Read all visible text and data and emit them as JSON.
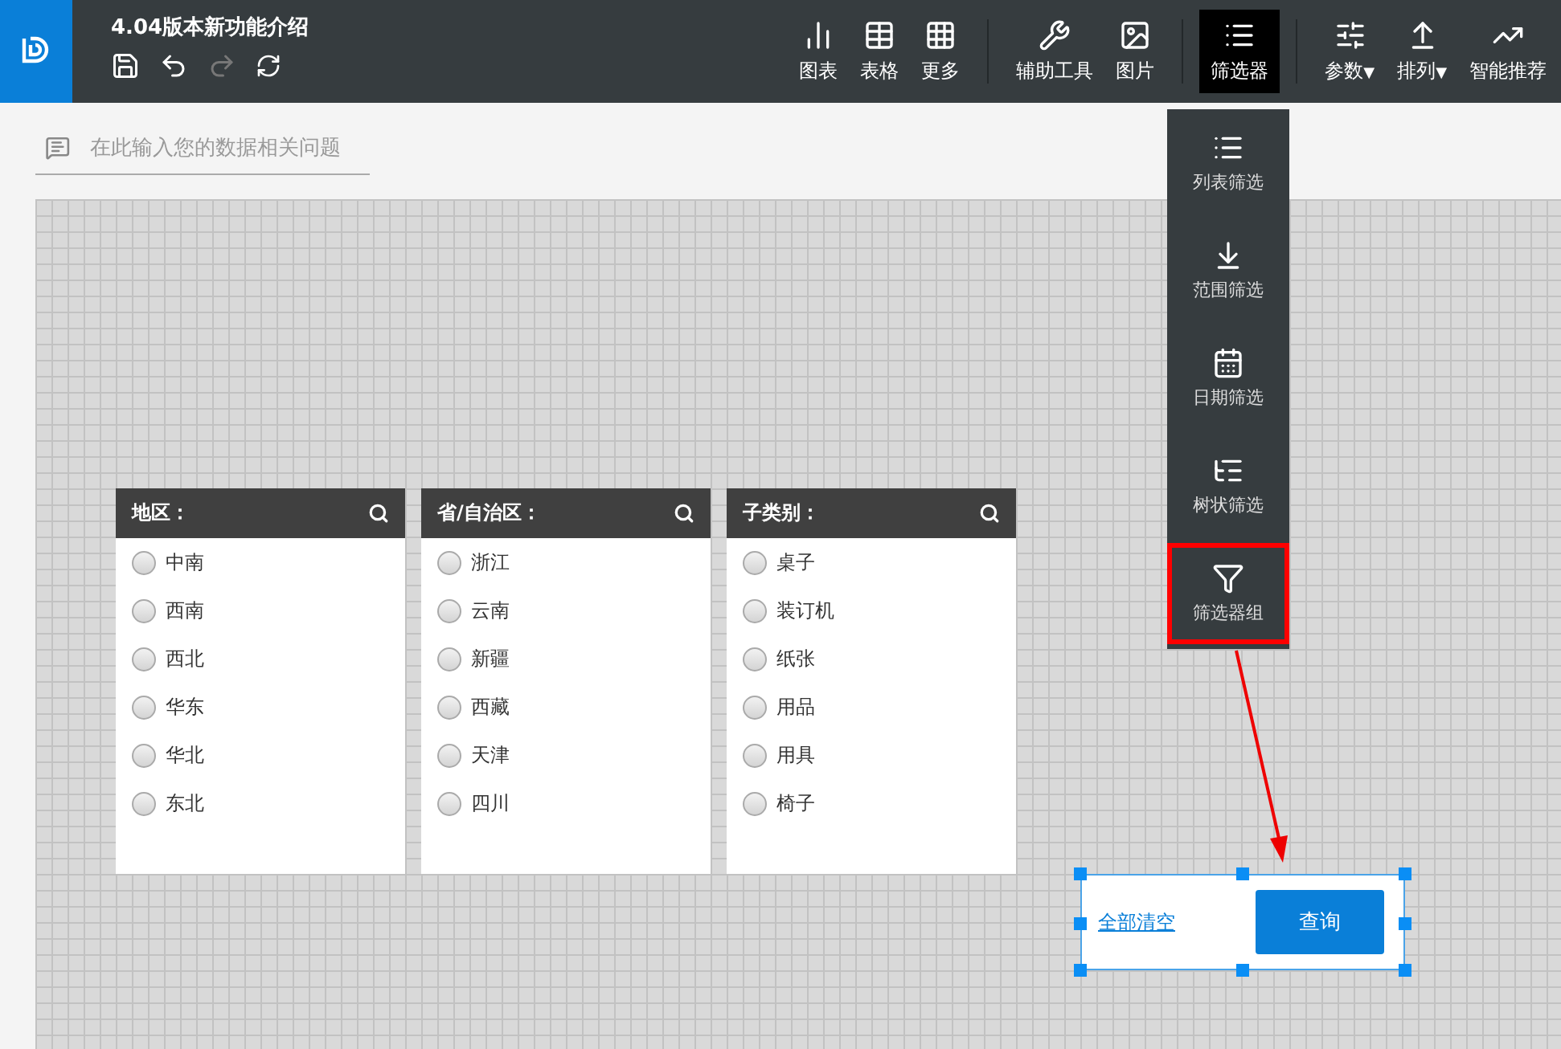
{
  "app": {
    "title": "4.04版本新功能介绍"
  },
  "toolbar": [
    {
      "label": "图表",
      "selected": false
    },
    {
      "label": "表格",
      "selected": false
    },
    {
      "label": "更多",
      "selected": false
    },
    {
      "label": "辅助工具",
      "selected": false
    },
    {
      "label": "图片",
      "selected": false
    },
    {
      "label": "筛选器",
      "selected": true
    },
    {
      "label": "参数",
      "caret": "▼",
      "selected": false
    },
    {
      "label": "排列",
      "caret": "▼",
      "selected": false
    },
    {
      "label": "智能推荐",
      "selected": false
    }
  ],
  "question": {
    "placeholder": "在此输入您的数据相关问题"
  },
  "filter_menu": [
    {
      "label": "列表筛选",
      "highlighted": false
    },
    {
      "label": "范围筛选",
      "highlighted": false
    },
    {
      "label": "日期筛选",
      "highlighted": false
    },
    {
      "label": "树状筛选",
      "highlighted": false
    },
    {
      "label": "筛选器组",
      "highlighted": true
    }
  ],
  "panels": [
    {
      "title": "地区：",
      "options": [
        {
          "label": "中南",
          "checked": false
        },
        {
          "label": "西南",
          "checked": false
        },
        {
          "label": "西北",
          "checked": false
        },
        {
          "label": "华东",
          "checked": false
        },
        {
          "label": "华北",
          "checked": false
        },
        {
          "label": "东北",
          "checked": false
        }
      ]
    },
    {
      "title": "省/自治区：",
      "options": [
        {
          "label": "浙江",
          "checked": false
        },
        {
          "label": "云南",
          "checked": false
        },
        {
          "label": "新疆",
          "checked": false
        },
        {
          "label": "西藏",
          "checked": false
        },
        {
          "label": "天津",
          "checked": false
        },
        {
          "label": "四川",
          "checked": false
        }
      ]
    },
    {
      "title": "子类别：",
      "options": [
        {
          "label": "桌子",
          "checked": false
        },
        {
          "label": "装订机",
          "checked": false
        },
        {
          "label": "纸张",
          "checked": false
        },
        {
          "label": "用品",
          "checked": false
        },
        {
          "label": "用具",
          "checked": false
        },
        {
          "label": "椅子",
          "checked": false
        }
      ]
    }
  ],
  "filter_group": {
    "clear_link": "全部清空",
    "query_button": "查询"
  }
}
